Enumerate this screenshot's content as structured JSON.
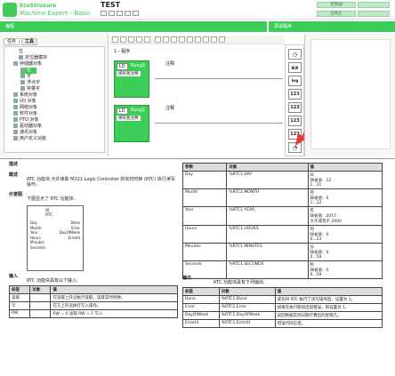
{
  "window": {
    "brand": "EcoStruxure",
    "app_name": "Machine Expert - Basic",
    "document_title": "TEST"
  },
  "top_buttons": [
    {
      "label": "无错误"
    },
    {
      "label": "已停止"
    }
  ],
  "green_bar": {
    "left": "编程",
    "right": "调试程序"
  },
  "left_panel": {
    "tabs": [
      "任务",
      "工具"
    ],
    "tree": [
      "位",
      "定位器模块",
      "存储器对象",
      "位",
      "字",
      "浮点字",
      "常量字",
      "系统对象",
      "I/O 对象",
      "网络对象",
      "软件对象",
      "PTO 对象",
      "驱动器对象",
      "通讯对象",
      "用户定义功能"
    ]
  },
  "ladder": {
    "rungs": [
      {
        "name": "Rung0",
        "comment_label": "注释",
        "code_label": "梯形图注释"
      },
      {
        "name": "Rung1",
        "comment_label": "注释",
        "code_label": "梯形图注释"
      }
    ],
    "lang": "LD",
    "step_label": "1 - 程序"
  },
  "palette_icons": [
    "clock",
    "ex",
    "log",
    "123",
    "123",
    "123",
    "123",
    "rtc"
  ],
  "doc": {
    "sections": {
      "desc": "描述",
      "overview": "概述",
      "pictogram": "示意图",
      "inputs": "输入",
      "outputs": "输出"
    },
    "overview_text": "RTC 功能块 允许读取 M221 Logic Controller 的实时时钟 (RTC) 执行读写操作。",
    "pictogram_text": "下图显示了 RTC 功能块:",
    "fb_lines": [
      "块",
      "RTC",
      "Day",
      "Month",
      "Year",
      "Hours",
      "Minutes",
      "Seconds",
      "Done",
      "Error",
      "DayOfWeek",
      "ErrorId"
    ],
    "input_intro": "RTC 功能块具有以下输入:",
    "output_intro": "RTC 功能块具有下列输出:",
    "var_table": {
      "headers": [
        "参数",
        "对象",
        "值"
      ],
      "rows": [
        [
          "Day",
          "%RTC1.DAY",
          "日\n缺省值：12\n1...31"
        ],
        [
          "Month",
          "%RTC1.MONTH",
          "月\n缺省值：6\n1...12"
        ],
        [
          "Year",
          "%RTC1.YEAR",
          "年\n缺省值：2017\n大于或等于 2000"
        ],
        [
          "Hours",
          "%RTC1.HOURS",
          "时\n缺省值：0\n0...23"
        ],
        [
          "Minutes",
          "%RTC1.MINUTES",
          "分\n缺省值：0\n0...59"
        ],
        [
          "Seconds",
          "%RTC1.SECONDS",
          "秒\n缺省值：0\n0...59"
        ]
      ]
    },
    "input_table": {
      "headers": [
        "标签",
        "对象",
        "值"
      ],
      "rows": [
        [
          "读取",
          "",
          "在读取上升沿执行读取，读取实时时钟。"
        ],
        [
          "写",
          "",
          "在写上升沿执行写入操作。"
        ],
        [
          "RW",
          "",
          "RW = 0 读取 RW = 1 写入"
        ]
      ]
    },
    "output_table": {
      "headers": [
        "标签",
        "对象",
        "值"
      ],
      "rows": [
        [
          "Done",
          "%RTC1.Done",
          "成功对 RTC 执行了读写操作后，设置为 1。"
        ],
        [
          "Error",
          "%RTC1.Error",
          "如果在执行期间出现错误，则设置为 1。"
        ],
        [
          "DayOfWeek",
          "%RTC1.DayOfWeek",
          "返回根据实际日期计算出的星期几。"
        ],
        [
          "ErrorId",
          "%RTC1.ErrorId",
          "错误代码信息。"
        ]
      ]
    }
  }
}
